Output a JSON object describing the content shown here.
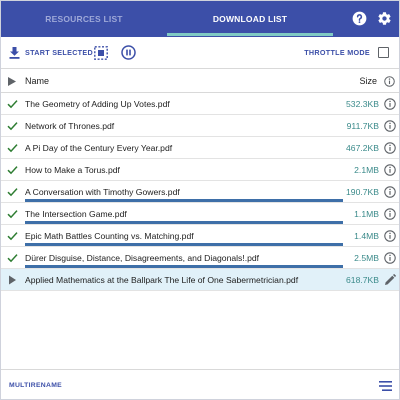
{
  "colors": {
    "header_bg": "#3c4fa8",
    "tab_active": "#ffffff",
    "tab_inactive": "#9ea8d8",
    "tab_indicator": "#80cbc4",
    "accent": "#3c4fa8",
    "check": "#2e7d32",
    "size_text": "#3a8a8a",
    "progress": "#3e6fa8",
    "active_row": "#e1f1f9"
  },
  "header": {
    "tabs": [
      {
        "label": "RESOURCES LIST",
        "active": false
      },
      {
        "label": "DOWNLOAD LIST",
        "active": true
      }
    ],
    "icons": [
      "help-icon",
      "gear-icon"
    ]
  },
  "toolbar": {
    "start_label": "START SELECTED",
    "select_icon": "select-all-icon",
    "pause_icon": "pause-icon",
    "throttle_label": "THROTTLE MODE",
    "throttle_checked": false
  },
  "table": {
    "columns": {
      "name": "Name",
      "size": "Size"
    },
    "rows": [
      {
        "name": "The Geometry of Adding Up Votes.pdf",
        "size": "532.3KB",
        "status": "done",
        "progress": null,
        "action_icon": "info-icon"
      },
      {
        "name": "Network of Thrones.pdf",
        "size": "911.7KB",
        "status": "done",
        "progress": null,
        "action_icon": "info-icon"
      },
      {
        "name": "A Pi Day of the Century Every Year.pdf",
        "size": "467.2KB",
        "status": "done",
        "progress": null,
        "action_icon": "info-icon"
      },
      {
        "name": "How to Make a Torus.pdf",
        "size": "2.1MB",
        "status": "done",
        "progress": null,
        "action_icon": "info-icon"
      },
      {
        "name": "A Conversation with Timothy Gowers.pdf",
        "size": "190.7KB",
        "status": "done",
        "progress": 1.0,
        "action_icon": "info-icon"
      },
      {
        "name": "The Intersection Game.pdf",
        "size": "1.1MB",
        "status": "done",
        "progress": 1.0,
        "action_icon": "info-icon"
      },
      {
        "name": "Epic Math Battles Counting vs. Matching.pdf",
        "size": "1.4MB",
        "status": "done",
        "progress": 1.0,
        "action_icon": "info-icon"
      },
      {
        "name": "Dürer Disguise, Distance, Disagreements, and Diagonals!.pdf",
        "size": "2.5MB",
        "status": "done",
        "progress": 1.0,
        "action_icon": "info-icon"
      },
      {
        "name": "Applied Mathematics at the Ballpark The Life of One Sabermetrician.pdf",
        "size": "618.7KB",
        "status": "pending",
        "progress": null,
        "action_icon": "edit-icon",
        "active": true
      }
    ]
  },
  "footer": {
    "multirename_label": "MULTIRENAME",
    "menu_icon": "menu-icon"
  }
}
